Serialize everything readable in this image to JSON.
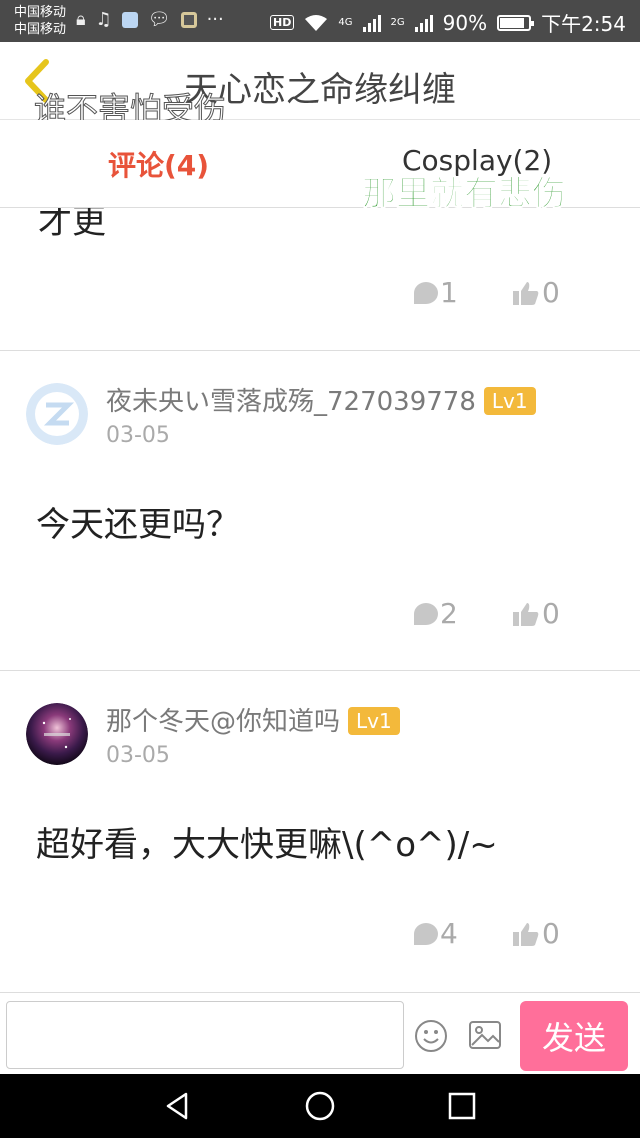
{
  "status_bar": {
    "carrier1": "中国移动",
    "carrier2": "中国移动",
    "hd": "HD",
    "net1": "4G",
    "net2": "2G",
    "battery": "90%",
    "time": "下午2:54",
    "more": "···"
  },
  "header": {
    "title": "天心恋之命缘纠缠",
    "overlay": "谁不害怕受伤"
  },
  "tabs": [
    {
      "label": "评论(4)"
    },
    {
      "label": "Cosplay(2)"
    }
  ],
  "tabs_overlay": "那里就有悲伤",
  "comments": [
    {
      "text_partial": "才更",
      "replies": "1",
      "likes": "0"
    },
    {
      "user": "夜未央い雪落成殇_727039778",
      "level": "Lv1",
      "date": "03-05",
      "text": "今天还更吗？",
      "replies": "2",
      "likes": "0"
    },
    {
      "user": "那个冬天@你知道吗",
      "level": "Lv1",
      "date": "03-05",
      "text": "超好看，大大快更嘛\\(^o^)/~",
      "replies": "4",
      "likes": "0"
    }
  ],
  "input_bar": {
    "placeholder": "",
    "send_label": "发送"
  },
  "colors": {
    "accent": "#e8533a",
    "send": "#ff6f9a",
    "level_badge": "#f3b93b",
    "overlay_green": "#2e9a2e"
  }
}
